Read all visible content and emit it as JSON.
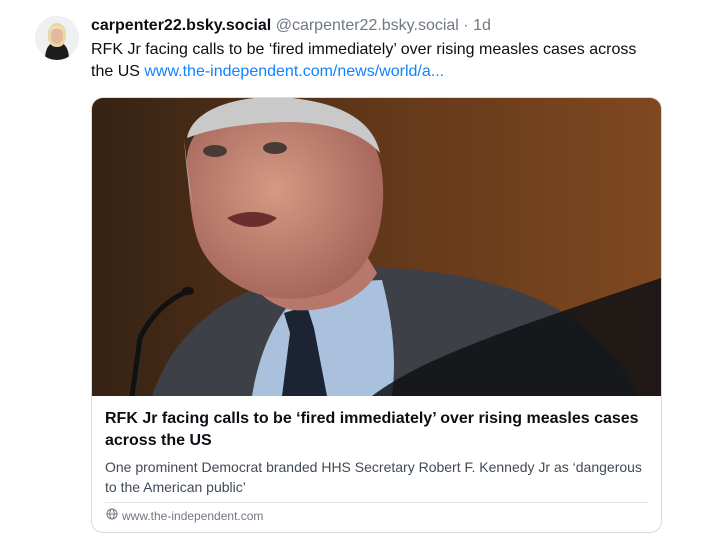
{
  "post": {
    "display_name": "carpenter22.bsky.social",
    "handle": "@carpenter22.bsky.social",
    "separator": "·",
    "timestamp": "1d",
    "text": "RFK Jr facing calls to be ‘fired immediately’ over rising measles cases across the US",
    "link_text": "www.the-independent.com/news/world/a..."
  },
  "card": {
    "title": "RFK Jr facing calls to be ‘fired immediately’ over rising measles cases across the US",
    "description": "One prominent Democrat branded HHS Secretary Robert F. Kennedy Jr as ‘dangerous to the American public’",
    "source": "www.the-independent.com",
    "source_icon": "globe-icon"
  },
  "colors": {
    "link": "#1083fe",
    "muted": "#6f7883",
    "border": "#d4dbe2"
  }
}
